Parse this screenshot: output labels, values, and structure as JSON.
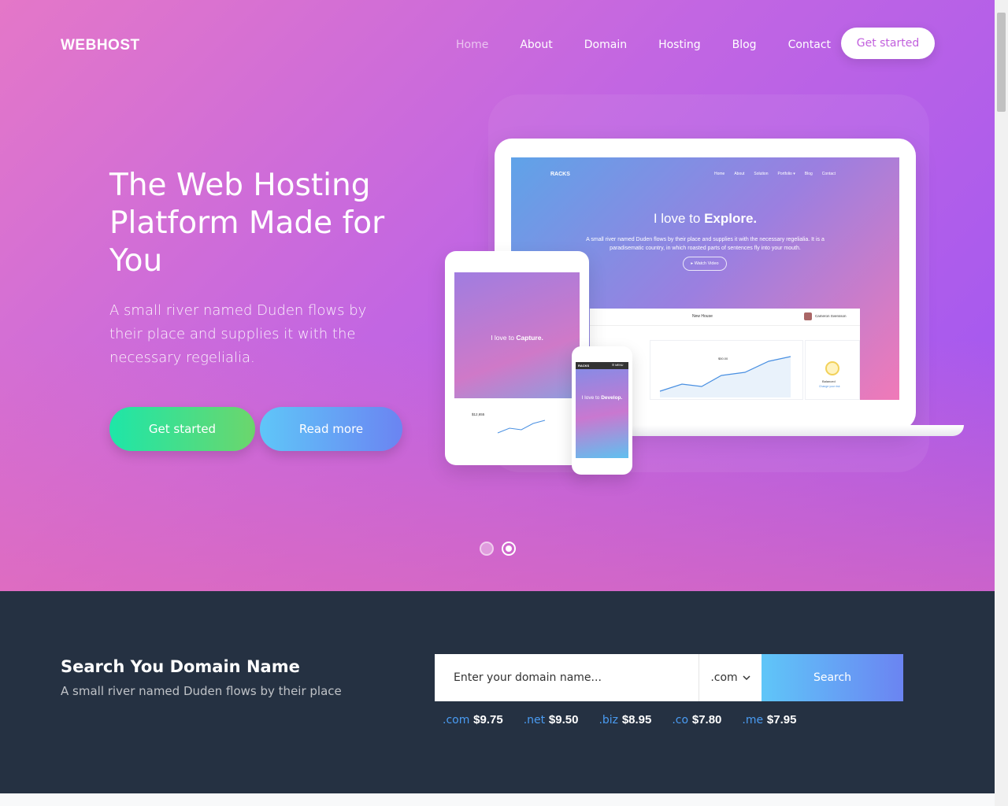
{
  "nav": {
    "brand": "WEBHOST",
    "items": [
      {
        "label": "Home",
        "active": true
      },
      {
        "label": "About"
      },
      {
        "label": "Domain"
      },
      {
        "label": "Hosting"
      },
      {
        "label": "Blog"
      },
      {
        "label": "Contact"
      }
    ],
    "cta": "Get started"
  },
  "hero": {
    "title": "The Web Hosting Platform Made for You",
    "subtitle": "A small river named Duden flows by their place and supplies it with the necessary regelialia.",
    "primary_button": "Get started",
    "secondary_button": "Read more",
    "slides_total": 2,
    "active_slide": 2
  },
  "mockup": {
    "laptop": {
      "brand": "RACKS",
      "menu": [
        "Home",
        "About",
        "Solution",
        "Portfolio ▾",
        "Blog",
        "Contact"
      ],
      "title_prefix": "I love to ",
      "title_bold": "Explore.",
      "text": "A small river named Duden flows by their place and supplies it with the necessary regelialia. It is a paradisematic country, in which roasted parts of sentences fly into your mouth.",
      "button": "▸ Watch Video",
      "dash_item": "New House",
      "user": "Cameron Svensson",
      "chart_value": "$50.00",
      "status": "Balanced",
      "status_link": "Change your risk"
    },
    "tablet": {
      "title_prefix": "I love to ",
      "title_bold": "Capture.",
      "stat": "$12,655"
    },
    "phone": {
      "brand": "RACKS",
      "menu": "☰ MENU",
      "title_prefix": "I love to ",
      "title_bold": "Develop."
    }
  },
  "domain": {
    "title": "Search You Domain Name",
    "subtitle": "A small river named Duden flows by their place",
    "input_placeholder": "Enter your domain name...",
    "tld_selected": ".com",
    "search_button": "Search",
    "prices": [
      {
        "tld": ".com",
        "price": "$9.75"
      },
      {
        "tld": ".net",
        "price": "$9.50"
      },
      {
        "tld": ".biz",
        "price": "$8.95"
      },
      {
        "tld": ".co",
        "price": "$7.80"
      },
      {
        "tld": ".me",
        "price": "$7.95"
      }
    ]
  },
  "colors": {
    "hero_start": "#e477c8",
    "hero_end": "#9d55f3",
    "dark_section": "#253142",
    "accent_green": "#1ee6a8",
    "accent_blue": "#5fc6f8",
    "tld_blue": "#4a9cf3"
  }
}
